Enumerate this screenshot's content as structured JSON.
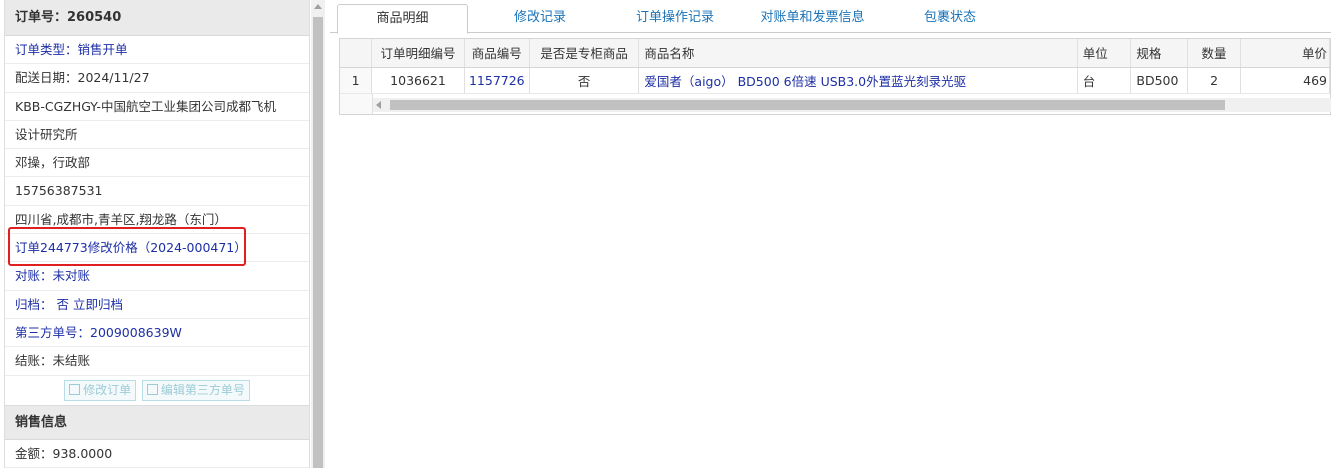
{
  "order": {
    "header": "订单号：260540",
    "rows": [
      "订单类型：销售开单",
      "配送日期：2024/11/27",
      "KBB-CGZHGY-中国航空工业集团公司成都飞机",
      "设计研究所",
      "邓操，行政部",
      "15756387531",
      "四川省,成都市,青羊区,翔龙路（东门）",
      "订单244773修改价格（2024-000471）",
      "对账：未对账",
      "归档： 否 立即归档",
      "第三方单号：2009008639W",
      "结账：未结账"
    ],
    "buttons": {
      "edit_order": "修改订单",
      "edit_third_party": "编辑第三方单号"
    }
  },
  "sales": {
    "header": "销售信息",
    "amount": "金额：938.0000"
  },
  "tabs": [
    "商品明细",
    "修改记录",
    "订单操作记录",
    "对账单和发票信息",
    "包裹状态"
  ],
  "grid": {
    "columns": [
      "",
      "订单明细编号",
      "商品编号",
      "是否是专柜商品",
      "商品名称",
      "单位",
      "规格",
      "数量",
      "单价"
    ],
    "rows": [
      [
        "1",
        "1036621",
        "1157726",
        "否",
        "爱国者（aigo） BD500 6倍速 USB3.0外置蓝光刻录光驱",
        "台",
        "BD500",
        "2",
        "469"
      ]
    ]
  },
  "colors": {
    "link": "#1d2fa5",
    "tab_link": "#1a73b8",
    "highlight": "#e02020"
  }
}
